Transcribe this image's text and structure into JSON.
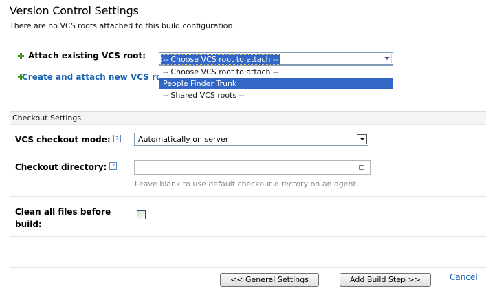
{
  "page": {
    "title": "Version Control Settings",
    "subtitle": "There are no VCS roots attached to this build configuration."
  },
  "attach": {
    "label": "Attach existing VCS root:",
    "select_value": "-- Choose VCS root to attach --",
    "options": [
      "-- Choose VCS root to attach --",
      "People Finder Trunk",
      "-- Shared VCS roots --"
    ],
    "highlighted_option": "People Finder Trunk"
  },
  "create": {
    "label": "Create and attach new VCS root"
  },
  "checkout": {
    "section_title": "Checkout Settings",
    "mode_label": "VCS checkout mode:",
    "mode_value": "Automatically on server",
    "dir_label": "Checkout directory:",
    "dir_value": "",
    "dir_hint": "Leave blank to use default checkout directory on an agent.",
    "clean_label_line1": "Clean all files before",
    "clean_label_line2": "build:",
    "clean_checked": false,
    "help_glyph": "?"
  },
  "footer": {
    "prev_label": "<< General Settings",
    "next_label": "Add Build Step >>",
    "cancel_label": "Cancel"
  }
}
